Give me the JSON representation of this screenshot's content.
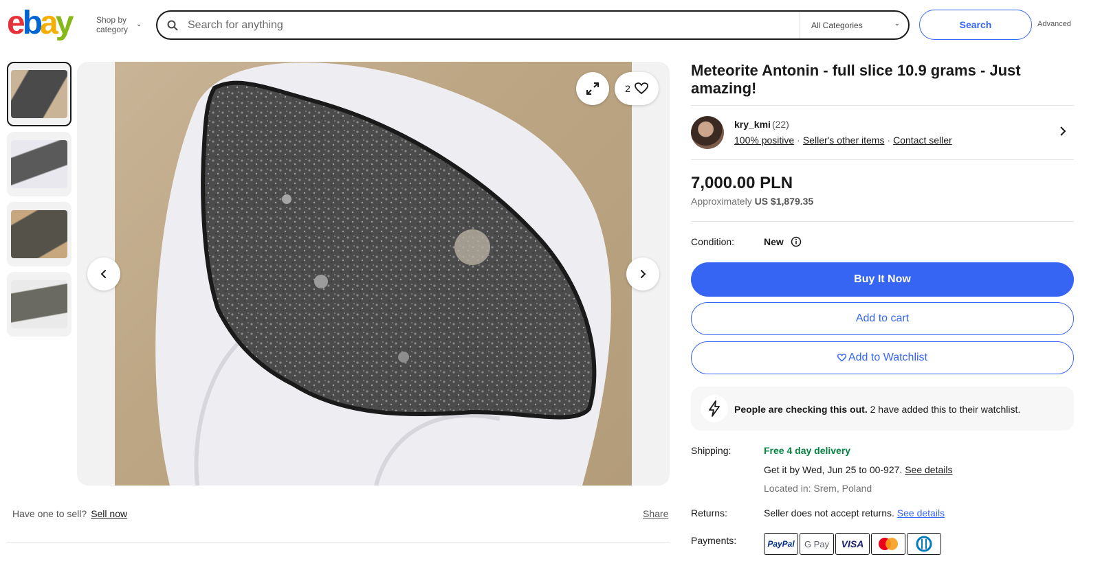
{
  "header": {
    "logo_letters": [
      "e",
      "b",
      "a",
      "y"
    ],
    "logo_colors": [
      "#e53238",
      "#0064d2",
      "#f5af02",
      "#86b817"
    ],
    "shop_by_line1": "Shop by",
    "shop_by_line2": "category",
    "search_placeholder": "Search for anything",
    "category_selected": "All Categories",
    "search_button": "Search",
    "advanced": "Advanced"
  },
  "gallery": {
    "thumbnail_count": 4,
    "watch_count": "2"
  },
  "below_image": {
    "have_one": "Have one to sell?",
    "sell_now": "Sell now",
    "share": "Share"
  },
  "listing": {
    "title": "Meteorite Antonin - full slice 10.9 grams - Just amazing!",
    "seller": {
      "name": "kry_kmi",
      "feedback_count": "(22)",
      "positive": "100% positive",
      "other_items": "Seller's other items",
      "contact": "Contact seller"
    },
    "price": "7,000.00 PLN",
    "approx_label": "Approximately",
    "approx_value": "US $1,879.35",
    "condition_label": "Condition:",
    "condition_value": "New",
    "buy_now": "Buy It Now",
    "add_to_cart": "Add to cart",
    "add_to_watchlist": "Add to Watchlist",
    "checking_bold": "People are checking this out.",
    "checking_rest": "2 have added this to their watchlist.",
    "shipping_label": "Shipping:",
    "shipping_free": "Free 4 day delivery",
    "shipping_get_it": "Get it by Wed, Jun 25 to 00-927.",
    "see_details": "See details",
    "located": "Located in: Srem, Poland",
    "returns_label": "Returns:",
    "returns_text": "Seller does not accept returns.",
    "returns_details": "See details",
    "payments_label": "Payments:",
    "payments": [
      "PayPal",
      "G Pay",
      "VISA",
      "mastercard",
      "diners"
    ]
  },
  "colors": {
    "accent": "#3665f3",
    "green": "#05823f"
  }
}
